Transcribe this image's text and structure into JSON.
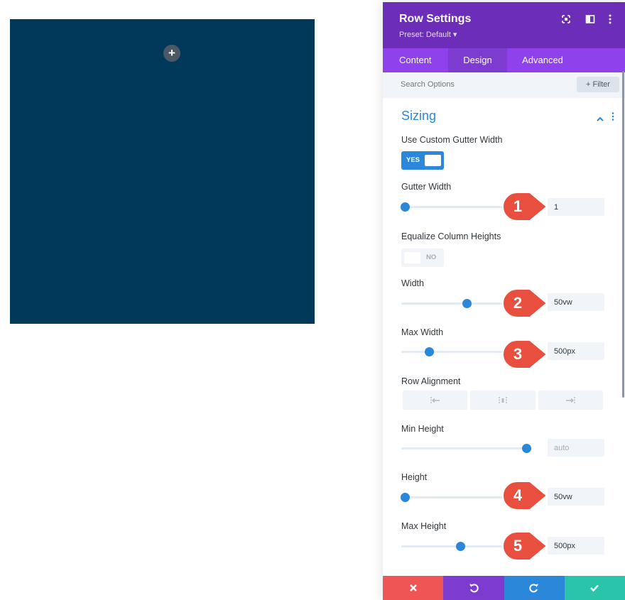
{
  "colors": {
    "row_background": "#00395a",
    "header_purple": "#6c2eb9",
    "tabs_purple": "#8f42ec",
    "accent_blue": "#2b87da",
    "cancel_red": "#ef5555",
    "undo_purple": "#7e3bd0",
    "redo_blue": "#2b87da",
    "save_green": "#29c4a9",
    "callout_red": "#e94f3e"
  },
  "canvas": {
    "add_row_icon": "plus-icon",
    "add_symbol": "+"
  },
  "panel": {
    "title": "Row Settings",
    "preset": "Preset: Default ▾",
    "header_icons": [
      "fullscreen-icon",
      "split-view-icon",
      "more-vertical-icon"
    ],
    "tabs": [
      {
        "label": "Content",
        "active": false
      },
      {
        "label": "Design",
        "active": true
      },
      {
        "label": "Advanced",
        "active": false
      }
    ],
    "search": {
      "placeholder": "Search Options"
    },
    "filter_label": "+ Filter",
    "section": {
      "title": "Sizing",
      "expanded": true
    },
    "fields": {
      "custom_gutter": {
        "label": "Use Custom Gutter Width",
        "toggle_text": "YES",
        "value": true
      },
      "gutter_width": {
        "label": "Gutter Width",
        "value": "1",
        "slider_percent": 3,
        "callout": "1"
      },
      "equalize": {
        "label": "Equalize Column Heights",
        "toggle_text": "NO",
        "value": false
      },
      "width": {
        "label": "Width",
        "value": "50vw",
        "slider_percent": 52,
        "callout": "2"
      },
      "max_width": {
        "label": "Max Width",
        "value": "500px",
        "slider_percent": 22,
        "callout": "3"
      },
      "row_alignment": {
        "label": "Row Alignment",
        "options": [
          "align-left-icon",
          "align-center-icon",
          "align-right-icon"
        ]
      },
      "min_height": {
        "label": "Min Height",
        "value": "auto",
        "slider_percent": 100
      },
      "height": {
        "label": "Height",
        "value": "50vw",
        "slider_percent": 3,
        "callout": "4"
      },
      "max_height": {
        "label": "Max Height",
        "value": "500px",
        "slider_percent": 47,
        "callout": "5"
      }
    },
    "footer": [
      "cancel-icon",
      "undo-icon",
      "redo-icon",
      "save-check-icon"
    ]
  }
}
